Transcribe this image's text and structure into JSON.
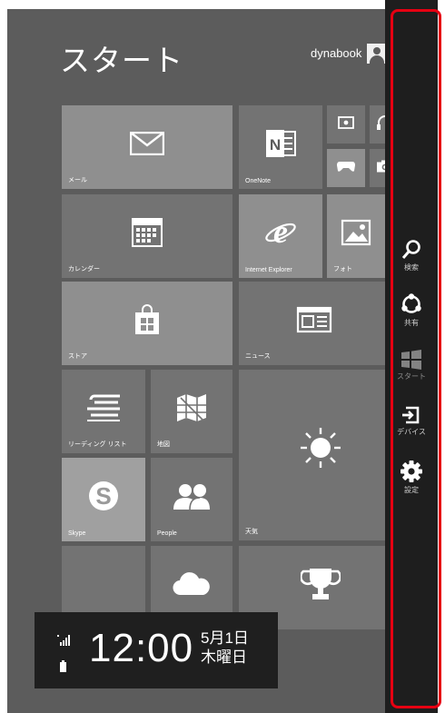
{
  "start": {
    "title": "スタート",
    "user": "dynabook"
  },
  "tiles": {
    "mail": "メール",
    "onenote": "OneNote",
    "calendar": "カレンダー",
    "ie": "Internet Explorer",
    "photos": "フォト",
    "store": "ストア",
    "news": "ニュース",
    "reading": "リーディング リスト",
    "maps": "地図",
    "weather": "天気",
    "skype": "Skype",
    "people": "People"
  },
  "charms": {
    "search": "検索",
    "share": "共有",
    "start": "スタート",
    "devices": "デバイス",
    "settings": "設定"
  },
  "clock": {
    "time": "12:00",
    "date_line1": "5月1日",
    "date_line2": "木曜日"
  },
  "colors": {
    "screen": "#5c5c5c",
    "tile": "#737373",
    "charms_bar": "#1e1e1e",
    "highlight": "#e60012"
  }
}
